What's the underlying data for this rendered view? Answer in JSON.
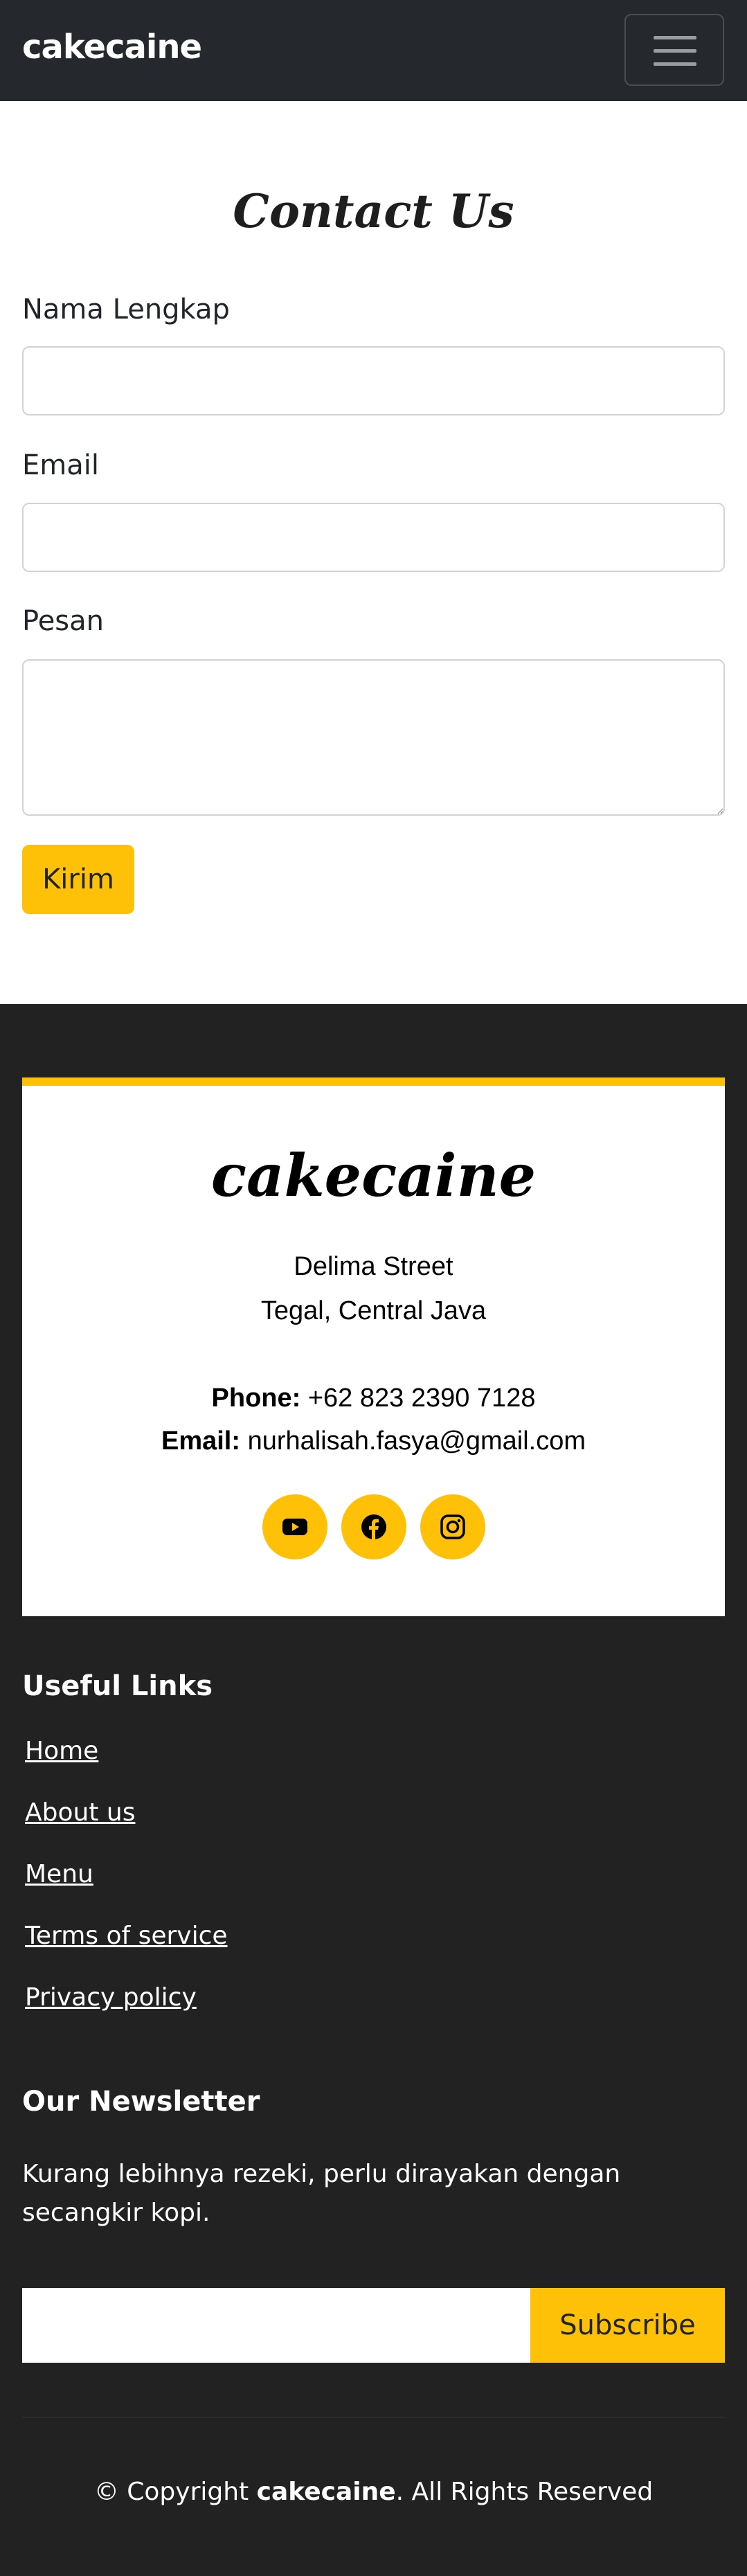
{
  "navbar": {
    "brand": "cakecaine",
    "toggler_icon": "hamburger-menu-icon"
  },
  "contact": {
    "title": "Contact Us",
    "name_label": "Nama Lengkap",
    "name_value": "",
    "email_label": "Email",
    "email_value": "",
    "message_label": "Pesan",
    "message_value": "",
    "submit_label": "Kirim"
  },
  "footer": {
    "logo": "cakecaine",
    "address_line1": "Delima Street",
    "address_line2": "Tegal, Central Java",
    "phone_label": "Phone:",
    "phone_value": "+62 823 2390 7128",
    "email_label": "Email:",
    "email_value": "nurhalisah.fasya@gmail.com",
    "socials": [
      {
        "icon": "youtube-icon"
      },
      {
        "icon": "facebook-icon"
      },
      {
        "icon": "instagram-icon"
      }
    ],
    "useful_links_heading": "Useful Links",
    "links": [
      "Home",
      "About us",
      "Menu",
      "Terms of service",
      "Privacy policy"
    ],
    "newsletter_heading": "Our Newsletter",
    "newsletter_text": "Kurang lebihnya rezeki, perlu dirayakan dengan secangkir kopi.",
    "newsletter_input_value": "",
    "subscribe_label": "Subscribe",
    "copyright_prefix": "© Copyright",
    "copyright_brand": "cakecaine",
    "copyright_suffix": ". All Rights Reserved"
  },
  "colors": {
    "accent": "#ffc107",
    "navbar_bg": "#25282c",
    "footer_bg": "#222222"
  }
}
